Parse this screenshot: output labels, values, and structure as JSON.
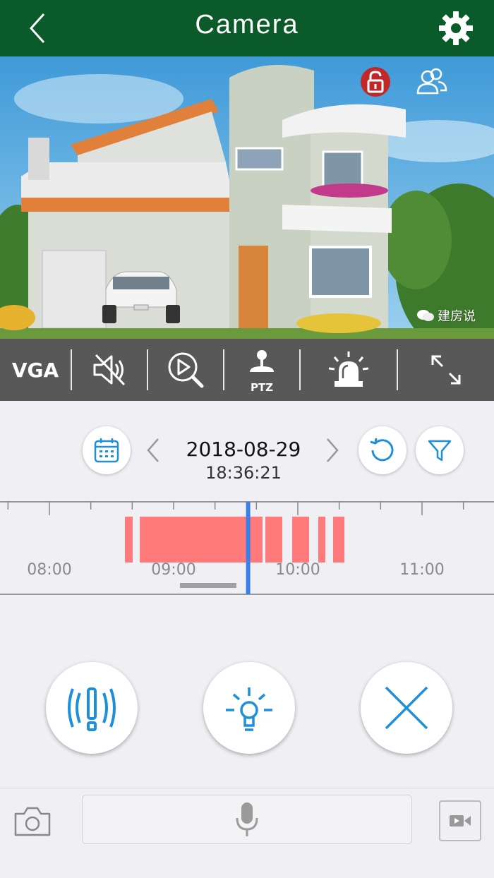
{
  "header": {
    "title": "Camera",
    "back_icon": "chevron-left-icon",
    "settings_icon": "gear-icon"
  },
  "video": {
    "lock_icon": "lock-icon",
    "users_icon": "users-icon",
    "watermark": "建房说"
  },
  "toolbar": {
    "quality_label": "VGA",
    "mute_icon": "speaker-muted-icon",
    "playback_icon": "playback-search-icon",
    "ptz_label": "PTZ",
    "alarm_icon": "siren-icon",
    "fullscreen_icon": "expand-icon"
  },
  "playback": {
    "date": "2018-08-29",
    "time": "18:36:21",
    "calendar_icon": "calendar-icon",
    "refresh_icon": "refresh-icon",
    "filter_icon": "filter-icon"
  },
  "timeline": {
    "labels": [
      "08:00",
      "09:00",
      "10:00",
      "11:00"
    ],
    "cursor_time": "09:36",
    "record_color": "#ff7b7b",
    "cursor_color": "#3b7fe8"
  },
  "actions": {
    "alert_icon": "alert-vibrate-icon",
    "light_icon": "light-bulb-icon",
    "close_icon": "close-icon"
  },
  "bottom": {
    "camera_icon": "camera-icon",
    "mic_icon": "microphone-icon",
    "record_icon": "video-record-icon"
  },
  "colors": {
    "header": "#0a5a2a",
    "accent": "#1e90d8",
    "toolbar": "#585858"
  }
}
